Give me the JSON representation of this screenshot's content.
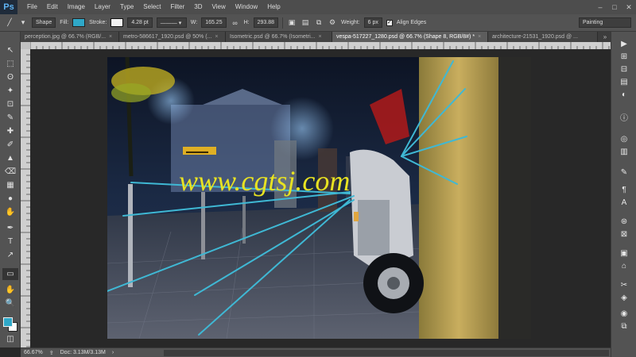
{
  "app": {
    "logo": "Ps"
  },
  "menu": [
    "File",
    "Edit",
    "Image",
    "Layer",
    "Type",
    "Select",
    "Filter",
    "3D",
    "View",
    "Window",
    "Help"
  ],
  "window_controls": [
    "–",
    "□",
    "✕"
  ],
  "options": {
    "mode": "Shape",
    "fill_label": "Fill:",
    "fill_color": "#2fa8c8",
    "stroke_label": "Stroke:",
    "stroke_width": "4.28 pt",
    "w_label": "W:",
    "w_value": "165.25",
    "h_label": "H:",
    "h_value": "293.88",
    "weight_label": "Weight:",
    "weight_value": "6 px",
    "align_edges": "Align Edges",
    "align_checked": "✓",
    "workspace": "Painting"
  },
  "tabs": [
    {
      "label": "perception.jpg @ 66.7% (RGB/...",
      "active": false
    },
    {
      "label": "metro-586617_1920.psd @ 50% (...",
      "active": false
    },
    {
      "label": "Isometric.psd @ 66.7% (Isometri...",
      "active": false
    },
    {
      "label": "vespa-517227_1280.psd @ 66.7% (Shape 8, RGB/8#) *",
      "active": true
    },
    {
      "label": "architecture-21531_1920.psd @ ...",
      "active": false
    }
  ],
  "tab_overflow": "»",
  "tab_close": "×",
  "photo": {
    "watermark": "www.cgtsj.com",
    "sign_text": "▬▬▬▬"
  },
  "colors": {
    "foreground": "#2fa8c8",
    "background": "#ffffff",
    "guide": "#3fb8d4"
  },
  "status": {
    "zoom": "66.67%",
    "doc": "Doc: 3.13M/3.13M",
    "arrow": "›"
  },
  "tools": [
    "↖",
    "⬚",
    "ʘ",
    "✦",
    "⊡",
    "✎",
    "✚",
    "✐",
    "▲",
    "⌫",
    "▦",
    "●",
    "✋",
    "✒",
    "T",
    "↗",
    "▭",
    "✋",
    "🔍"
  ],
  "panel_icons": [
    "▶",
    "⊞",
    "⊟",
    "▤",
    "◐",
    "ⓘ",
    "◎",
    "▥",
    "✎",
    "¶",
    "A",
    "⊛",
    "⊠",
    "▣",
    "⌂",
    "✂",
    "◈",
    "◉",
    "⧉"
  ]
}
